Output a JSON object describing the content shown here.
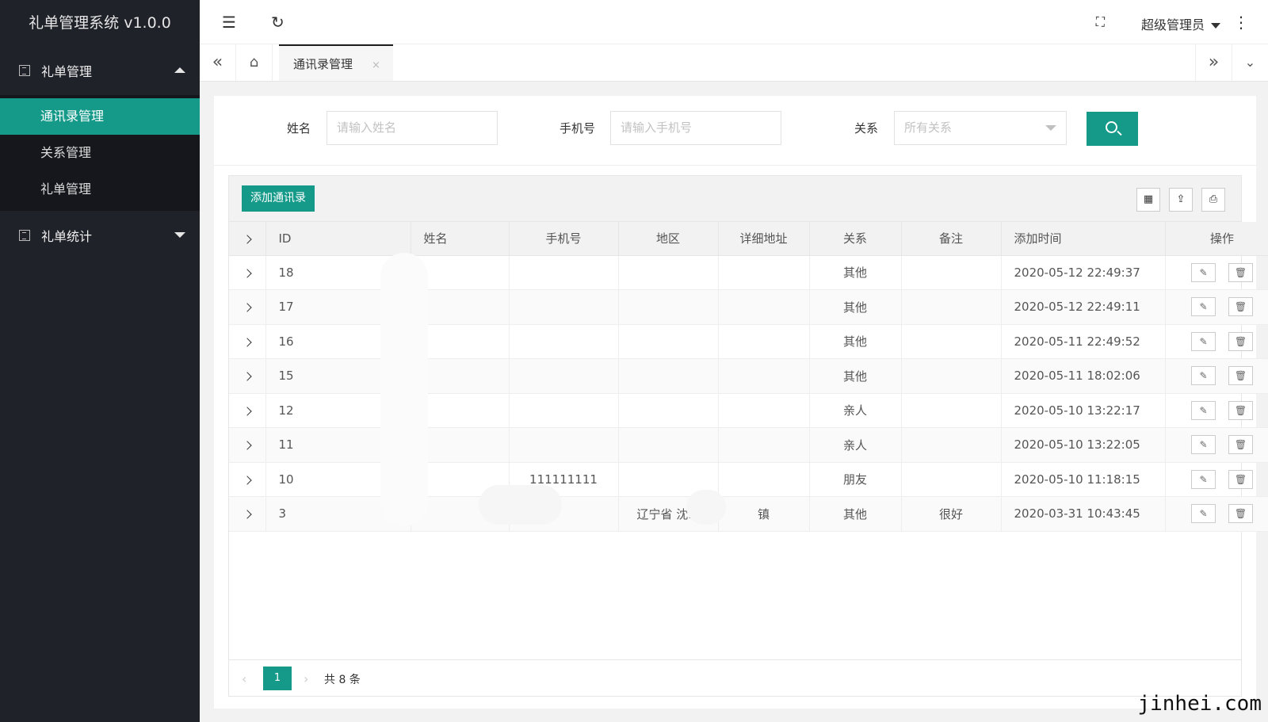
{
  "app_title": "礼单管理系统 v1.0.0",
  "sidebar": {
    "groups": [
      {
        "label": "礼单管理",
        "items": [
          "通讯录管理",
          "关系管理",
          "礼单管理"
        ]
      },
      {
        "label": "礼单统计"
      }
    ]
  },
  "header": {
    "user": "超级管理员"
  },
  "tabs": {
    "active": "通讯录管理",
    "close": "×"
  },
  "filter": {
    "name_label": "姓名",
    "name_placeholder": "请输入姓名",
    "phone_label": "手机号",
    "phone_placeholder": "请输入手机号",
    "relation_label": "关系",
    "relation_value": "所有关系"
  },
  "toolbar": {
    "add_label": "添加通讯录"
  },
  "table": {
    "columns": [
      "ID",
      "姓名",
      "手机号",
      "地区",
      "详细地址",
      "关系",
      "备注",
      "添加时间",
      "操作"
    ],
    "rows": [
      {
        "id": "18",
        "name": "",
        "phone": "",
        "region": "",
        "address": "",
        "relation": "其他",
        "note": "",
        "time": "2020-05-12 22:49:37"
      },
      {
        "id": "17",
        "name": "",
        "phone": "",
        "region": "",
        "address": "",
        "relation": "其他",
        "note": "",
        "time": "2020-05-12 22:49:11"
      },
      {
        "id": "16",
        "name": "",
        "phone": "",
        "region": "",
        "address": "",
        "relation": "其他",
        "note": "",
        "time": "2020-05-11 22:49:52"
      },
      {
        "id": "15",
        "name": "",
        "phone": "",
        "region": "",
        "address": "",
        "relation": "其他",
        "note": "",
        "time": "2020-05-11 18:02:06"
      },
      {
        "id": "12",
        "name": "",
        "phone": "",
        "region": "",
        "address": "",
        "relation": "亲人",
        "note": "",
        "time": "2020-05-10 13:22:17"
      },
      {
        "id": "11",
        "name": "",
        "phone": "",
        "region": "",
        "address": "",
        "relation": "亲人",
        "note": "",
        "time": "2020-05-10 13:22:05"
      },
      {
        "id": "10",
        "name": "",
        "phone": "111111111",
        "region": "",
        "address": "",
        "relation": "朋友",
        "note": "",
        "time": "2020-05-10 11:18:15"
      },
      {
        "id": "3",
        "name": "",
        "phone": "",
        "region": "辽宁省 沈...",
        "address": "镇",
        "relation": "其他",
        "note": "很好",
        "time": "2020-03-31 10:43:45"
      }
    ]
  },
  "pagination": {
    "current": "1",
    "total": "共 8 条"
  },
  "watermark": "jinhei.com",
  "icons": {
    "edit": "✎",
    "delete": "🗑"
  }
}
